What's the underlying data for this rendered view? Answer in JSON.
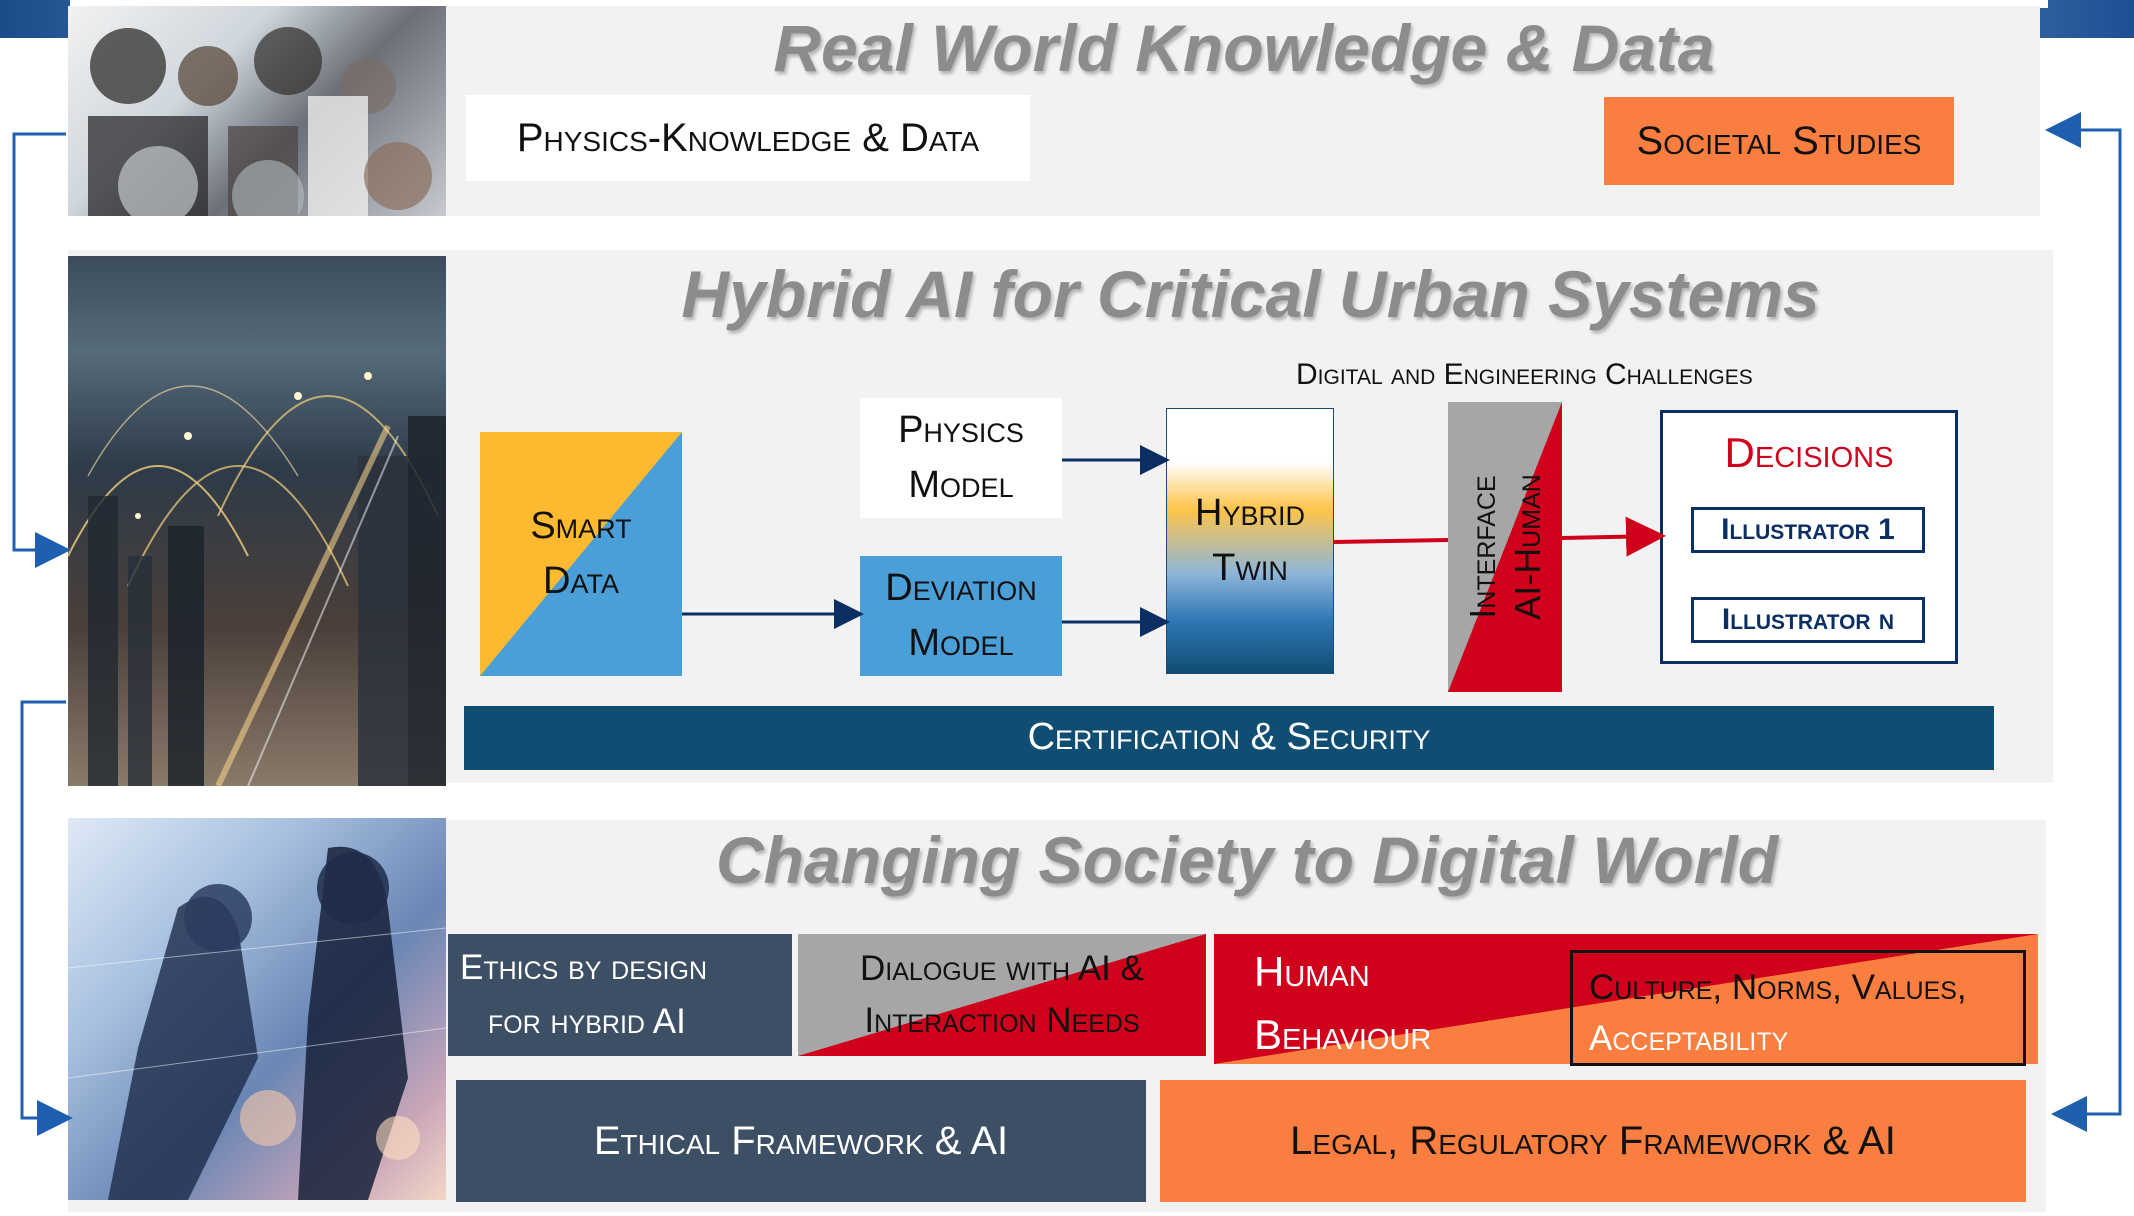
{
  "sections": {
    "top": {
      "title": "Real World Knowledge & Data",
      "physics_knowledge": "Physics-Knowledge & Data",
      "societal_studies": "Societal Studies"
    },
    "middle": {
      "title": "Hybrid AI for Critical Urban Systems",
      "challenges": "Digital and Engineering Challenges",
      "smart_data": [
        "Smart",
        "Data"
      ],
      "physics_model": [
        "Physics",
        "Model"
      ],
      "deviation_model": [
        "Deviation",
        "Model"
      ],
      "hybrid_twin": [
        "Hybrid",
        "Twin"
      ],
      "interface": [
        "Interface",
        "AI-Human"
      ],
      "decisions": "Decisions",
      "illustrator_1": "Illustrator 1",
      "illustrator_n": "Illustrator n",
      "certification": "Certification & Security"
    },
    "bottom": {
      "title": "Changing Society to Digital World",
      "ethics_design": [
        "Ethics by design",
        "for hybrid AI"
      ],
      "dialogue": [
        "Dialogue with AI &",
        "Interaction Needs"
      ],
      "human_behaviour": [
        "Human",
        "Behaviour"
      ],
      "culture": [
        "Culture, Norms, Values,",
        "Acceptability"
      ],
      "ethical_framework": "Ethical Framework & AI",
      "legal_framework": "Legal, Regulatory Framework & AI"
    }
  },
  "colors": {
    "orange": "#f97e3f",
    "navy_bar": "#0f4d73",
    "slate": "#3d4f64",
    "red": "#d0021b",
    "blue": "#4a9fd8",
    "yellow": "#fdb92f",
    "gray": "#a6a6a6",
    "arrow_blue": "#1f5fb0"
  }
}
